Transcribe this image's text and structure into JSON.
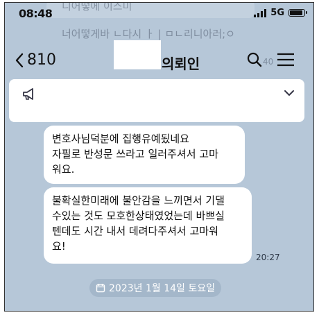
{
  "status_bar": {
    "time": "08:48",
    "network": "5G"
  },
  "ghost_overlay": {
    "line1": "니어떻에 이스미",
    "line2": "너어떻게바 ㄴ다시 ㅏ | ㅁㄴ리니아러;ㅇ",
    "line2_suffix": "40"
  },
  "header": {
    "back_count": "810",
    "title": "의뢰인"
  },
  "messages": {
    "bubble1": {
      "line1": "변호사님덕분에 집행유예됬네요",
      "line2": "자필로 반성문 쓰라고 일러주셔서 고마",
      "line3": "워요."
    },
    "bubble2": {
      "line1": "불확실한미래에 불안감을 느끼면서 기댈",
      "line2": "수있는 것도 모호한상태였었는데 바쁘실",
      "line3": "텐데도 시간 내서 데려다주셔서 고마워",
      "line4": "요!"
    },
    "time": "20:27"
  },
  "date_divider": {
    "label": "2023년 1월 14일 토요일"
  },
  "icons": [
    "chevron-left-icon",
    "search-icon",
    "menu-icon",
    "megaphone-icon",
    "chevron-down-icon",
    "calendar-icon"
  ],
  "colors": {
    "chat_background": "#b6c7d8",
    "bubble": "#ffffff",
    "date_pill": "#96aac0"
  }
}
